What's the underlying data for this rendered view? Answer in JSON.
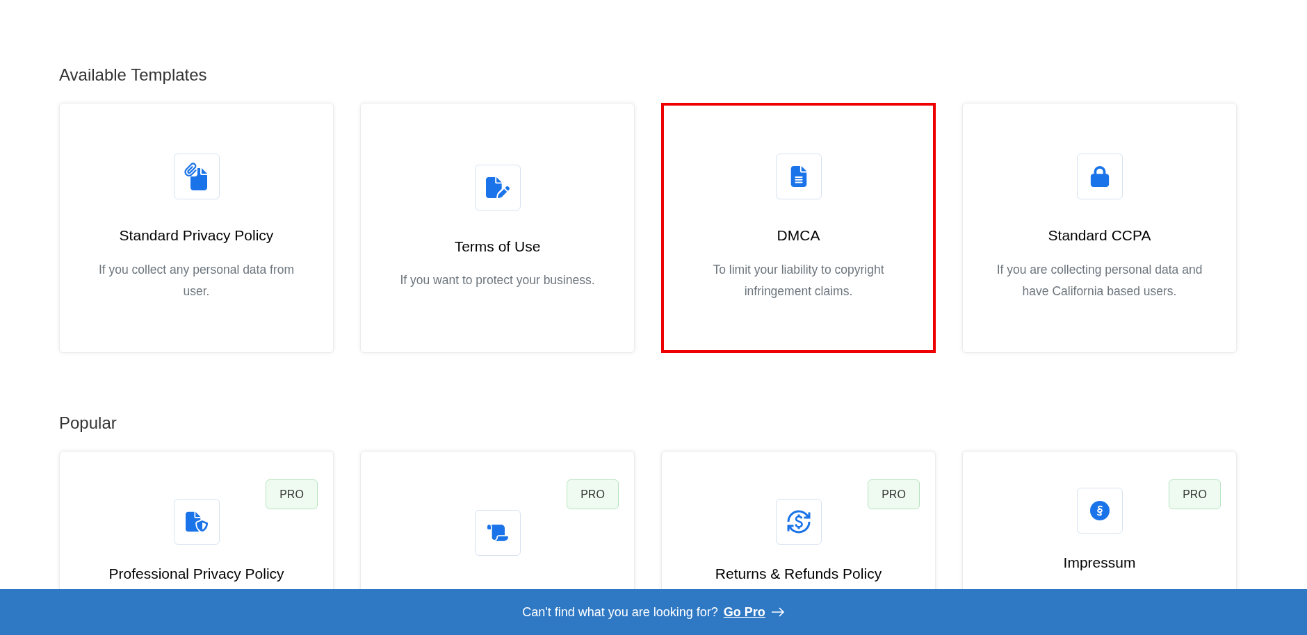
{
  "sections": [
    {
      "title": "Available Templates",
      "templates": [
        {
          "title": "Standard Privacy Policy",
          "description": "If you collect any personal data from user.",
          "highlighted": false
        },
        {
          "title": "Terms of Use",
          "description": "If you want to protect your business.",
          "highlighted": false
        },
        {
          "title": "DMCA",
          "description": "To limit your liability to copyright infringement claims.",
          "highlighted": true
        },
        {
          "title": "Standard CCPA",
          "description": "If you are collecting personal data and have California based users.",
          "highlighted": false
        }
      ]
    },
    {
      "title": "Popular",
      "templates": [
        {
          "title": "Professional Privacy Policy",
          "badge": "PRO",
          "highlighted": false
        },
        {
          "badge": "PRO",
          "highlighted": false
        },
        {
          "title": "Returns & Refunds Policy",
          "badge": "PRO",
          "highlighted": false
        },
        {
          "title": "Impressum",
          "badge": "PRO",
          "highlighted": false
        }
      ]
    }
  ],
  "banner": {
    "text": "Can't find what you are looking for?",
    "link": "Go Pro"
  }
}
